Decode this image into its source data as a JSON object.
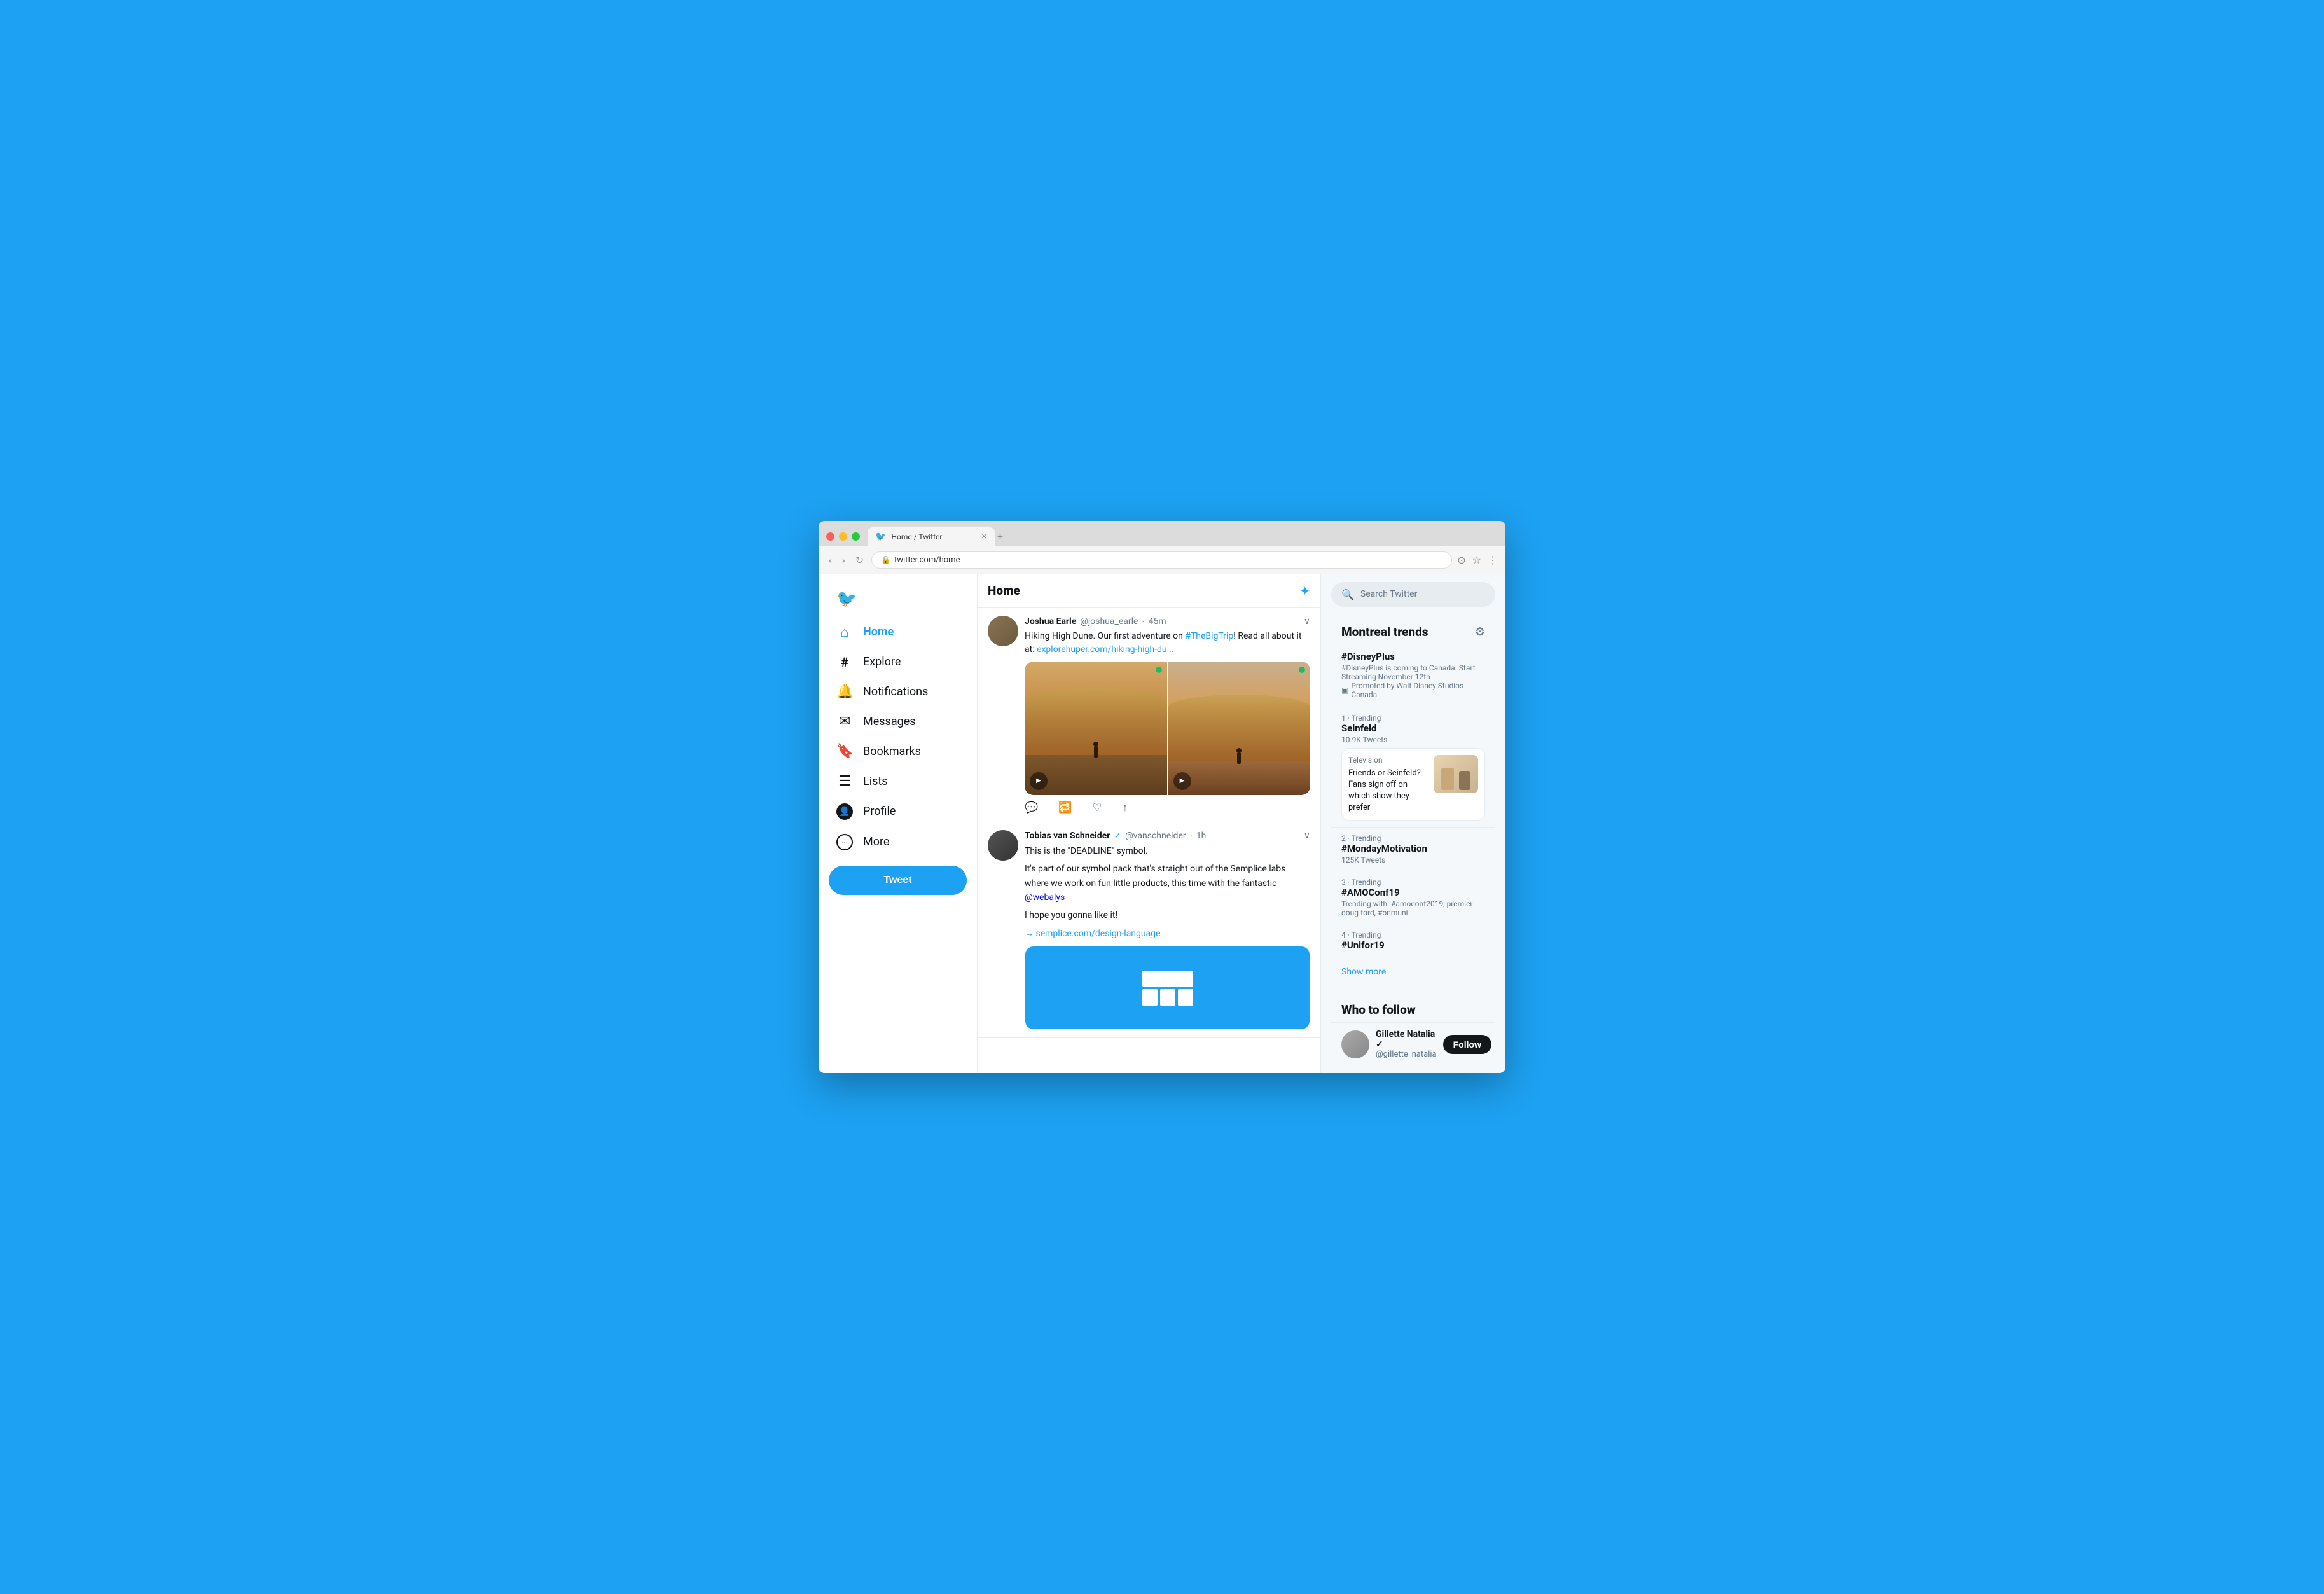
{
  "browser": {
    "tab_title": "Home / Twitter",
    "url": "twitter.com/home",
    "favicon": "🐦"
  },
  "sidebar": {
    "logo": "🐦",
    "items": [
      {
        "id": "home",
        "label": "Home",
        "icon": "⌂",
        "active": true
      },
      {
        "id": "explore",
        "label": "Explore",
        "icon": "#",
        "active": false
      },
      {
        "id": "notifications",
        "label": "Notifications",
        "icon": "🔔",
        "active": false
      },
      {
        "id": "messages",
        "label": "Messages",
        "icon": "✉",
        "active": false
      },
      {
        "id": "bookmarks",
        "label": "Bookmarks",
        "icon": "🔖",
        "active": false
      },
      {
        "id": "lists",
        "label": "Lists",
        "icon": "☰",
        "active": false
      },
      {
        "id": "profile",
        "label": "Profile",
        "icon": "👤",
        "active": false
      },
      {
        "id": "more",
        "label": "More",
        "icon": "⋯",
        "active": false
      }
    ],
    "tweet_button": "Tweet"
  },
  "feed": {
    "title": "Home",
    "tweets": [
      {
        "id": "tweet1",
        "user_name": "Joshua Earle",
        "user_handle": "@joshua_earle",
        "time": "45m",
        "text": "Hiking High Dune. Our first adventure on #TheBigTrip! Read all about it at: explorehuper.com/hiking-high-du...",
        "hashtag": "#TheBigTrip",
        "link": "explorehuper.com/hiking-high-du...",
        "has_images": true
      },
      {
        "id": "tweet2",
        "user_name": "Tobias van Schneider",
        "user_handle": "@vanschneider",
        "time": "1h",
        "verified": true,
        "text1": "This is the \"DEADLINE\" symbol.",
        "text2": "It's part of our symbol pack that's straight out of the Semplice labs where we work on fun little products, this time with the fantastic @webalys",
        "text3": "I hope you gonna like it!",
        "link": "→ semplice.com/design-language",
        "has_link_preview": true
      }
    ]
  },
  "right_sidebar": {
    "search_placeholder": "Search Twitter",
    "trends": {
      "title": "Montreal trends",
      "items": [
        {
          "type": "promoted",
          "tag": "#DisneyPlus",
          "sub": "#DisneyPlus is coming to Canada. Start Streaming November 12th",
          "promo": "Promoted by Walt Disney Studios Canada"
        },
        {
          "type": "trend",
          "rank": "1 · Trending",
          "tag": "Seinfeld",
          "count": "10.9K Tweets",
          "has_card": true,
          "card_category": "Television",
          "card_text": "Friends or Seinfeld? Fans sign off on which show they prefer"
        },
        {
          "type": "trend",
          "rank": "2 · Trending",
          "tag": "#MondayMotivation",
          "count": "125K Tweets"
        },
        {
          "type": "trend",
          "rank": "3 · Trending",
          "tag": "#AMOConf19",
          "count": "Trending with: #amoconf2019, premier doug ford, #onmuni"
        },
        {
          "type": "trend",
          "rank": "4 · Trending",
          "tag": "#Unifor19",
          "count": ""
        }
      ],
      "show_more": "Show more"
    },
    "who_to_follow": {
      "title": "Who to follow",
      "items": [
        {
          "name": "Gillette Natalia ✓",
          "handle": "@gillette_natalia"
        }
      ]
    }
  }
}
